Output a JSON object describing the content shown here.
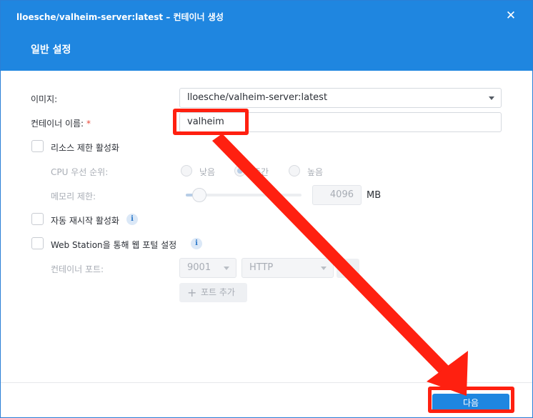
{
  "window": {
    "title": "lloesche/valheim-server:latest – 컨테이너 생성",
    "section_title": "일반 설정"
  },
  "form": {
    "image_label": "이미지:",
    "image_value": "lloesche/valheim-server:latest",
    "container_name_label": "컨테이너 이름:",
    "required_mark": "*",
    "container_name_value": "valheim",
    "resource_limit_label": "리소스 제한 활성화",
    "cpu_priority_label": "CPU 우선 순위:",
    "cpu_options": [
      "낮음",
      "중간",
      "높음"
    ],
    "cpu_selected": "중간",
    "memory_limit_label": "메모리 제한:",
    "memory_value": "4096",
    "memory_unit": "MB",
    "auto_restart_label": "자동 재시작 활성화",
    "web_station_label": "Web Station을 통해 웹 포털 설정",
    "container_port_label": "컨테이너 포트:",
    "port_value": "9001",
    "protocol_value": "HTTP",
    "add_port_label": "포트 추가",
    "info_glyph": "i"
  },
  "footer": {
    "next_label": "다음"
  },
  "annotation": {
    "color": "#ff2010"
  },
  "colors": {
    "header_blue": "#1f86e0",
    "primary_button": "#1f86e0"
  }
}
